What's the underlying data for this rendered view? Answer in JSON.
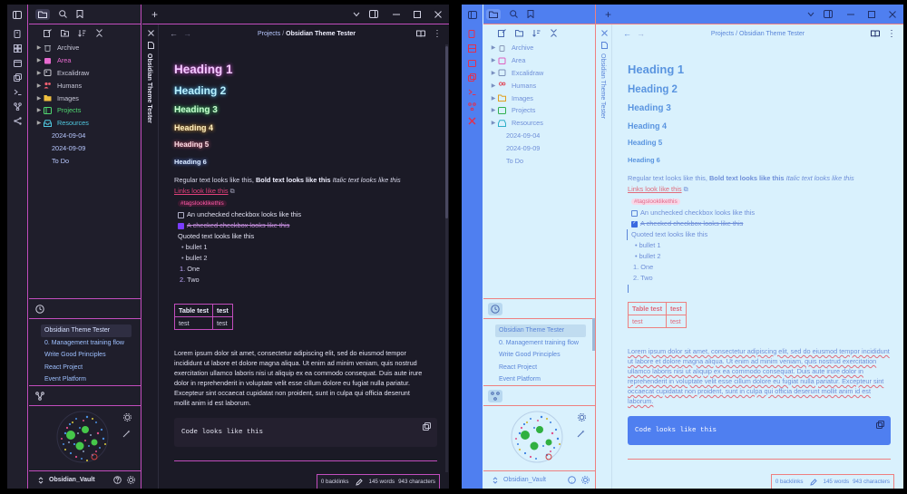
{
  "dark": {
    "tree": [
      {
        "label": "Archive",
        "icon": "trash-icon",
        "color": "#9fa3ad"
      },
      {
        "label": "Area",
        "icon": "calendar-icon",
        "color": "#e86ad0"
      },
      {
        "label": "Excalidraw",
        "icon": "image-icon",
        "color": "#c8c8d0"
      },
      {
        "label": "Humans",
        "icon": "users-icon",
        "color": "#f06070"
      },
      {
        "label": "Images",
        "icon": "folder-icon",
        "color": "#f0c040"
      },
      {
        "label": "Projects",
        "icon": "project-icon",
        "color": "#50d870"
      },
      {
        "label": "Resources",
        "icon": "inbox-icon",
        "color": "#50c8e0"
      }
    ],
    "loose": [
      "2024-09-04",
      "2024-09-09",
      "To Do"
    ],
    "recent": [
      "Obsidian Theme Tester",
      "0. Management training flow",
      "Write Good Principles",
      "React Project",
      "Event Platform"
    ],
    "vault_name": "Obsidian_Vault",
    "breadcrumb_parent": "Projects",
    "breadcrumb_sep": "/",
    "breadcrumb_current": "Obsidian Theme Tester",
    "vertical_tab": "Obsidian Theme Tester",
    "status": {
      "backlinks": "0 backlinks",
      "words": "145 words",
      "chars": "943 characters"
    }
  },
  "light": {
    "tree": [
      "Archive",
      "Area",
      "Excalidraw",
      "Humans",
      "Images",
      "Projects",
      "Resources"
    ],
    "loose": [
      "2024-09-04",
      "2024-09-09",
      "To Do"
    ],
    "recent": [
      "Obsidian Theme Tester",
      "0. Management training flow",
      "Write Good Principles",
      "React Project",
      "Event Platform"
    ],
    "vault_name": "Obsidian_Vault",
    "breadcrumb_parent": "Projects",
    "breadcrumb_sep": "/",
    "breadcrumb_current": "Obsidian Theme Tester",
    "vertical_tab": "Obsidian Theme Tester",
    "status": {
      "backlinks": "0 backlinks",
      "words": "145 words",
      "chars": "943 characters"
    }
  },
  "note": {
    "h1": "Heading 1",
    "h2": "Heading 2",
    "h3": "Heading 3",
    "h4": "Heading 4",
    "h5": "Heading 5",
    "h6": "Heading 6",
    "regular": "Regular text looks like this,",
    "bold": "Bold text looks like this",
    "italic": "Italic text looks like this",
    "link": "Links look like this",
    "tag": "#tagslooklikethis",
    "unchecked": "An unchecked checkbox looks like this",
    "checked": "A checked checkbox looks like this",
    "quote": "Quoted text looks like this",
    "bullets": [
      "bullet 1",
      "bullet 2"
    ],
    "numbered": [
      "One",
      "Two"
    ],
    "numbered_markers": [
      "1.",
      "2."
    ],
    "table_headers": [
      "Table test",
      "test"
    ],
    "table_row": [
      "test",
      "test"
    ],
    "lorem": "Lorem ipsum dolor sit amet, consectetur adipiscing elit, sed do eiusmod tempor incididunt ut labore et dolore magna aliqua. Ut enim ad minim veniam, quis nostrud exercitation ullamco laboris nisi ut aliquip ex ea commodo consequat. Duis aute irure dolor in reprehenderit in voluptate velit esse cillum dolore eu fugiat nulla pariatur. Excepteur sint occaecat cupidatat non proident, sunt in culpa qui officia deserunt mollit anim id est laborum.",
    "code": "Code looks like this"
  },
  "colors": {
    "dark_accent": "#c24dbd",
    "light_ribbon": "#4f7ff0",
    "light_border": "#ee8080",
    "link_dark": "#e0407a",
    "link_light": "#e06a7a"
  }
}
